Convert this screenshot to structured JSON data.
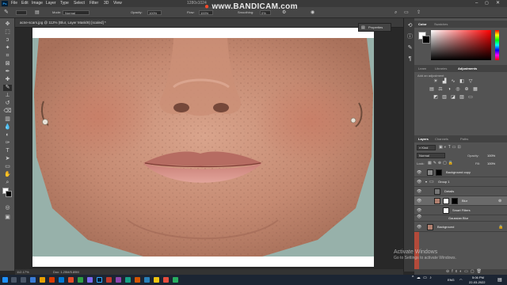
{
  "menubar": {
    "items": [
      "File",
      "Edit",
      "Image",
      "Layer",
      "Type",
      "Select",
      "Filter",
      "3D",
      "View"
    ],
    "recorder_overlay": "www.BANDICAM.com",
    "resolution": "1280x1024"
  },
  "options_bar": {
    "mode_label": "Mode:",
    "mode_value": "Normal",
    "opacity_label": "Opacity:",
    "opacity_value": "100%",
    "flow_label": "Flow:",
    "flow_value": "100%",
    "smoothing_label": "Smoothing:",
    "smoothing_value": "0%"
  },
  "document": {
    "tab_title": "acne-scars.jpg @ 112% (Blur, Layer Mask/8) [scaled] *",
    "zoom": "112.17%",
    "doc_info": "Doc: 1.25M/5.89M",
    "properties_label": "Properties"
  },
  "color_panel": {
    "tabs": [
      "Color",
      "Swatches"
    ],
    "accent": "#ff0000"
  },
  "adjustments_panel": {
    "tabs": [
      "Learn",
      "Libraries",
      "Adjustments"
    ],
    "subtitle": "Add an adjustment"
  },
  "layers_panel": {
    "tabs": [
      "Layers",
      "Channels",
      "Paths"
    ],
    "filter_kind": "Kind",
    "blend_mode": "Normal",
    "opacity_label": "Opacity:",
    "opacity_value": "100%",
    "lock_label": "Lock:",
    "fill_label": "Fill:",
    "fill_value": "100%",
    "layers": [
      {
        "name": "Background copy",
        "thumb": "#888"
      },
      {
        "name": "Group 1",
        "thumb": "folder"
      },
      {
        "name": "Details",
        "thumb": "#777"
      },
      {
        "name": "Blur",
        "thumb": "#b08070",
        "selected": true
      },
      {
        "name": "Smart Filters",
        "thumb": "#fff"
      },
      {
        "name": "Gaussian Blur",
        "thumb": "none"
      },
      {
        "name": "Background",
        "thumb": "#b08070",
        "locked": true
      }
    ]
  },
  "windows_watermark": {
    "line1": "Activate Windows",
    "line2": "Go to Settings to activate Windows."
  },
  "taskbar": {
    "language": "ENG",
    "time": "5:06 PM",
    "date": "22-03-2022"
  }
}
